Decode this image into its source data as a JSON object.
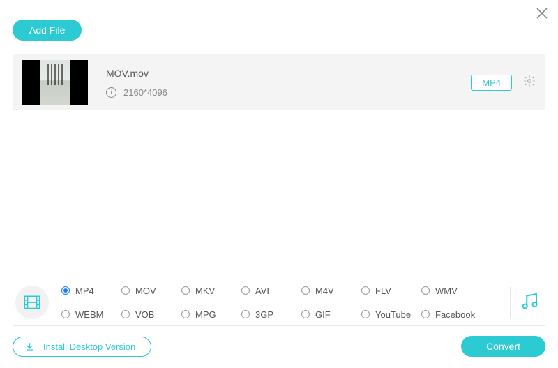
{
  "header": {
    "add_file_label": "Add File"
  },
  "file": {
    "name": "MOV.mov",
    "resolution": "2160*4096",
    "target_format": "MP4"
  },
  "formats": {
    "row1": [
      "MP4",
      "MOV",
      "MKV",
      "AVI",
      "M4V",
      "FLV",
      "WMV"
    ],
    "row2": [
      "WEBM",
      "VOB",
      "MPG",
      "3GP",
      "GIF",
      "YouTube",
      "Facebook"
    ],
    "selected": "MP4"
  },
  "footer": {
    "install_label": "Install Desktop Version",
    "convert_label": "Convert"
  }
}
